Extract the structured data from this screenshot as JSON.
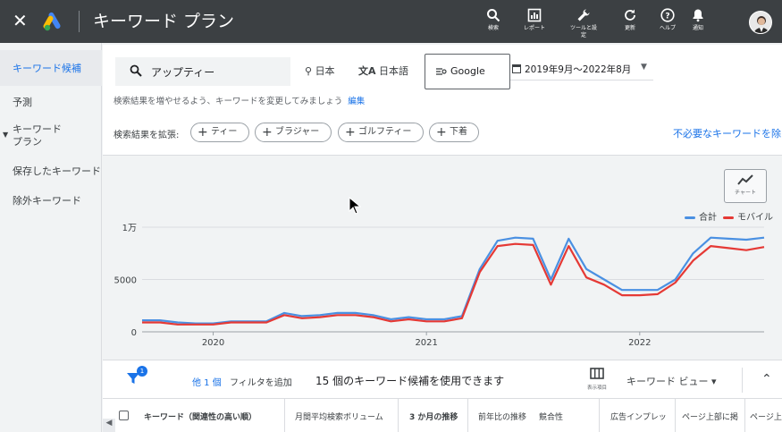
{
  "app": {
    "title": "キーワード プラン"
  },
  "toolbar": [
    {
      "label": "検索",
      "icon": "search-icon"
    },
    {
      "label": "レポート",
      "icon": "report-icon"
    },
    {
      "label": "ツールと設\n定",
      "icon": "wrench-icon"
    },
    {
      "label": "更新",
      "icon": "refresh-icon"
    },
    {
      "label": "ヘルプ",
      "icon": "help-icon"
    },
    {
      "label": "通知",
      "icon": "bell-icon"
    }
  ],
  "sidebar": {
    "items": [
      {
        "label": "キーワード候補"
      },
      {
        "label": "予測"
      },
      {
        "label": "キーワード\nプラン"
      },
      {
        "label": "保存したキーワード"
      },
      {
        "label": "除外キーワード"
      }
    ]
  },
  "search": {
    "keyword": "アップティー",
    "location": "日本",
    "language": "日本語",
    "network": "Google",
    "date_range": "2019年9月～2022年8月",
    "hint": "検索結果を増やせるよう、キーワードを変更してみましょう",
    "edit_label": "編集",
    "expand_label": "検索結果を拡張:",
    "chips": [
      "ティー",
      "ブラジャー",
      "ゴルフティー",
      "下着"
    ],
    "negative_link": "不必要なキーワードを除"
  },
  "chart_toggle_label": "チャート",
  "chart_data": {
    "type": "line",
    "x": [
      "2019-09",
      "2019-10",
      "2019-11",
      "2019-12",
      "2020-01",
      "2020-02",
      "2020-03",
      "2020-04",
      "2020-05",
      "2020-06",
      "2020-07",
      "2020-08",
      "2020-09",
      "2020-10",
      "2020-11",
      "2020-12",
      "2021-01",
      "2021-02",
      "2021-03",
      "2021-04",
      "2021-05",
      "2021-06",
      "2021-07",
      "2021-08",
      "2021-09",
      "2021-10",
      "2021-11",
      "2021-12",
      "2022-01",
      "2022-02",
      "2022-03",
      "2022-04",
      "2022-05",
      "2022-06",
      "2022-07",
      "2022-08"
    ],
    "series": [
      {
        "name": "合計",
        "color": "#4a90e2",
        "values": [
          1100,
          1100,
          900,
          800,
          800,
          1000,
          1000,
          1000,
          1800,
          1500,
          1600,
          1800,
          1800,
          1600,
          1200,
          1400,
          1200,
          1200,
          1500,
          6000,
          8700,
          9000,
          8900,
          5000,
          8900,
          6000,
          5000,
          4000,
          4000,
          4000,
          5000,
          7500,
          9000,
          8900,
          8800,
          9000
        ]
      },
      {
        "name": "モバイル",
        "color": "#e53935",
        "values": [
          900,
          900,
          700,
          700,
          700,
          900,
          900,
          900,
          1600,
          1300,
          1400,
          1600,
          1600,
          1400,
          1000,
          1200,
          1000,
          1000,
          1300,
          5700,
          8200,
          8400,
          8300,
          4500,
          8200,
          5200,
          4500,
          3500,
          3500,
          3600,
          4700,
          6800,
          8200,
          8000,
          7800,
          8100
        ]
      }
    ],
    "ylim": [
      0,
      10000
    ],
    "yticks": [
      "0",
      "5000",
      "1万"
    ],
    "xticks": [
      "2020",
      "2021",
      "2022"
    ],
    "legend": "top-right",
    "grid": true
  },
  "keyword_bar": {
    "badge": "1",
    "count_link": "他 1 個",
    "add_filter": "フィルタを追加",
    "available": "15 個のキーワード候補を使用できます",
    "columns_label": "表示項目",
    "view_label": "キーワード ビュー ▾"
  },
  "table": {
    "headers": [
      "キーワード（関連性の高い順）",
      "月間平均検索ボリューム",
      "3 か月の推移",
      "前年比の推移",
      "競合性",
      "広告インプレッ",
      "ページ上部に掲",
      "ページ上"
    ]
  }
}
